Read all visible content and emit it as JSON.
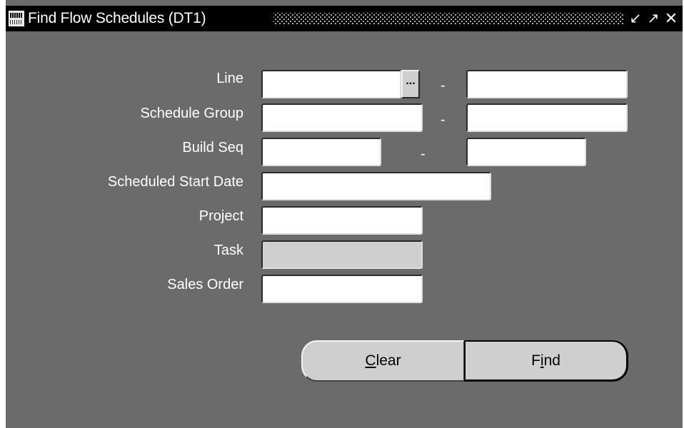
{
  "window": {
    "title": "Find Flow Schedules (DT1)",
    "controls": {
      "minimize_icon": "↙",
      "maximize_icon": "↗",
      "close_icon": "✕"
    }
  },
  "form": {
    "fields": {
      "line": {
        "label": "Line",
        "from_value": "",
        "to_value": "",
        "separator": "-",
        "lov_label": "..."
      },
      "schedule_group": {
        "label": "Schedule Group",
        "from_value": "",
        "to_value": "",
        "separator": "-"
      },
      "build_seq": {
        "label": "Build Seq",
        "from_value": "",
        "to_value": "",
        "separator": "-"
      },
      "scheduled_start_date": {
        "label": "Scheduled Start Date",
        "value": ""
      },
      "project": {
        "label": "Project",
        "value": ""
      },
      "task": {
        "label": "Task",
        "value": ""
      },
      "sales_order": {
        "label": "Sales Order",
        "value": ""
      }
    }
  },
  "buttons": {
    "clear": {
      "mnemonic": "C",
      "rest": "lear"
    },
    "find": {
      "before": "F",
      "mnemonic": "i",
      "rest": "nd"
    }
  },
  "colors": {
    "background": "#6b6b6b",
    "titlebar": "#000000",
    "field": "#ffffff",
    "field_disabled": "#cfcfcf",
    "button": "#cfcfcf"
  }
}
